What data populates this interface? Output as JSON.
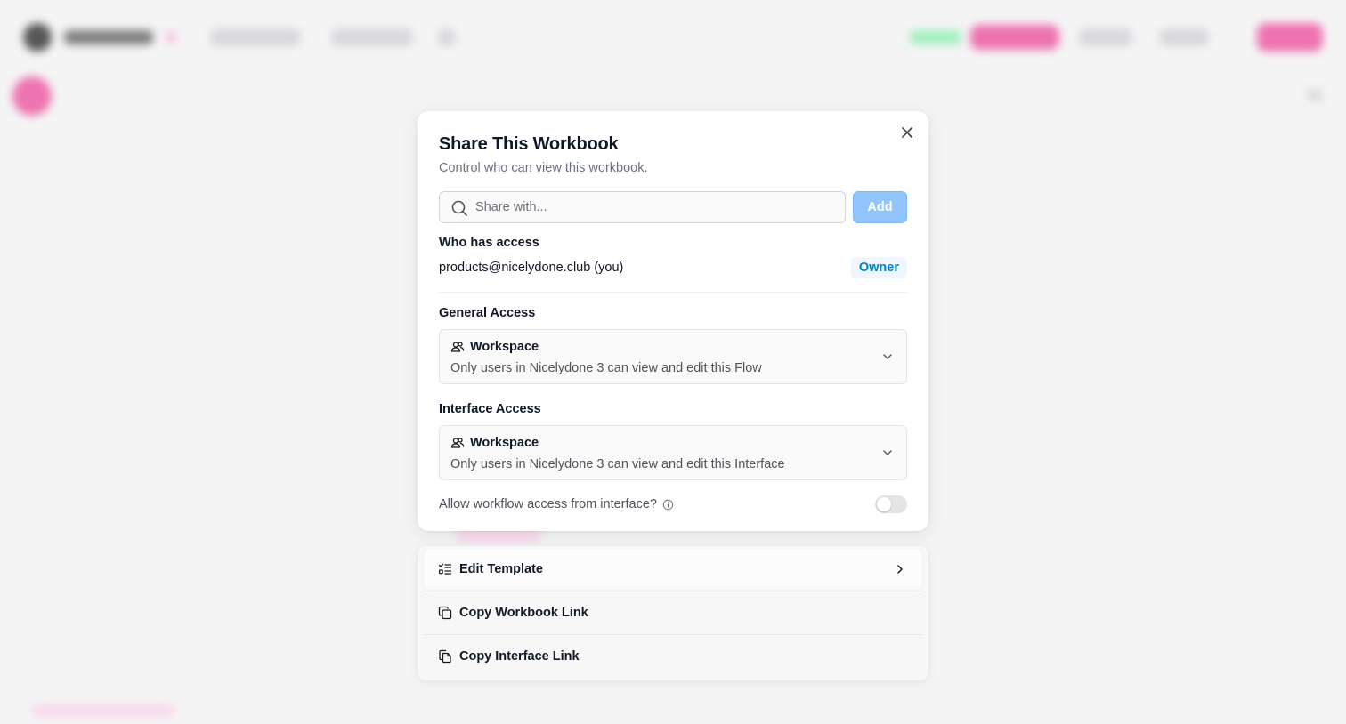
{
  "modal": {
    "title": "Share This Workbook",
    "subtitle": "Control who can view this workbook.",
    "share_input_placeholder": "Share with...",
    "add_button": "Add",
    "who_has_access_label": "Who has access",
    "owner": {
      "email": "products@nicelydone.club (you)",
      "role": "Owner"
    },
    "general_access": {
      "label": "General Access",
      "selected_title": "Workspace",
      "selected_description": "Only users in Nicelydone 3 can view and edit this Flow"
    },
    "interface_access": {
      "label": "Interface Access",
      "selected_title": "Workspace",
      "selected_description": "Only users in Nicelydone 3 can view and edit this Interface"
    },
    "workflow_toggle": {
      "label": "Allow workflow access from interface?",
      "enabled": false
    }
  },
  "menu": {
    "items": [
      {
        "label": "Edit Template",
        "icon": "list-checks-icon"
      },
      {
        "label": "Copy Workbook Link",
        "icon": "copy-icon"
      },
      {
        "label": "Copy Interface Link",
        "icon": "files-icon"
      }
    ]
  },
  "colors": {
    "accent_blue": "#93c5fd",
    "owner_badge_text": "#0284c7",
    "brand_pink": "#ec4899"
  }
}
